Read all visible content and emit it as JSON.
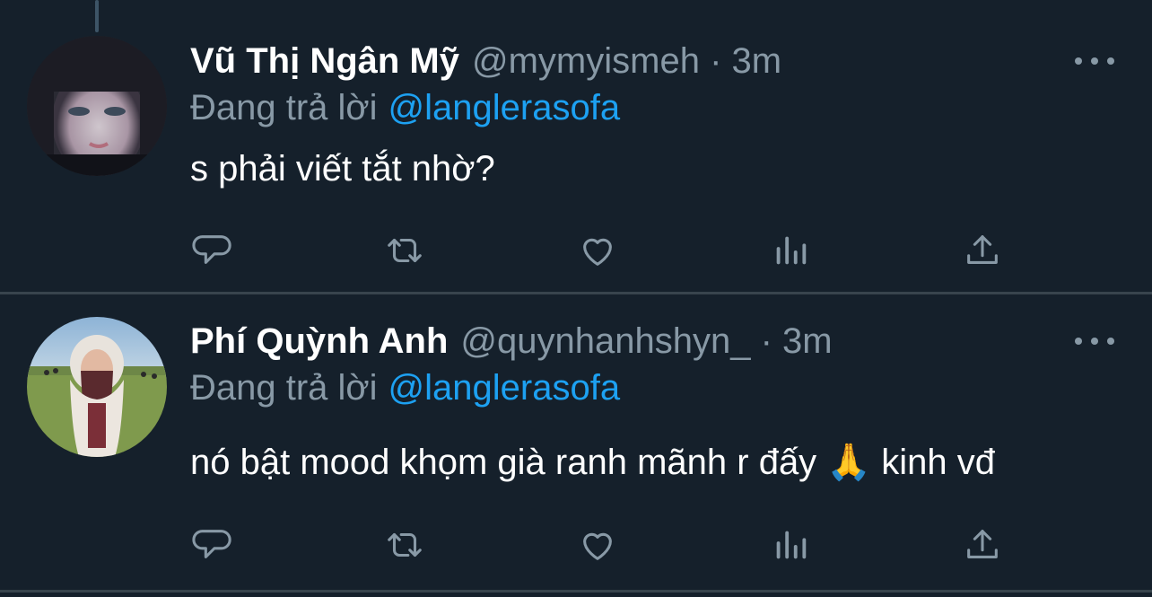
{
  "tweets": [
    {
      "display_name": "Vũ Thị Ngân Mỹ",
      "handle": "@mymyisme h",
      "dot": "·",
      "time": "3m",
      "reply_label": "Đang trả lời",
      "reply_to": "@langlerasofa",
      "text": "s phải viết tắt nhờ?"
    },
    {
      "display_name": "Phí Quỳnh Anh",
      "handle": "@quynhanhshyn_",
      "dot": "·",
      "time": "3m",
      "reply_label": "Đang trả lời",
      "reply_to": "@langlerasofa",
      "text": "nó bật mood khọm già ranh mãnh r đấy 🙏  kinh vđ"
    }
  ],
  "icons": {
    "reply": "comment-icon",
    "retweet": "retweet-icon",
    "like": "heart-icon",
    "analytics": "analytics-icon",
    "share": "share-icon",
    "more": "more-icon"
  },
  "colors": {
    "background": "#15202b",
    "text": "#ffffff",
    "muted": "#8899a6",
    "link": "#1da1f2",
    "divider": "#38444d"
  }
}
